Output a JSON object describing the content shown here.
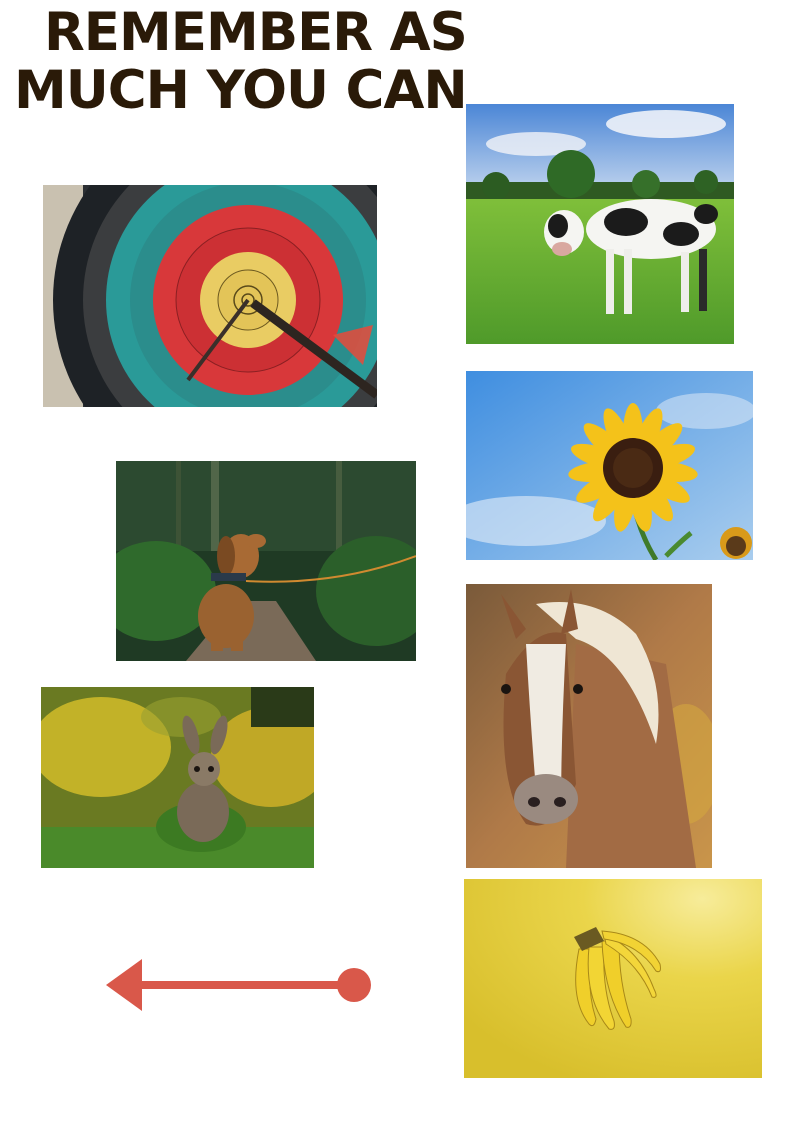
{
  "title": {
    "line1": "REMEMBER AS",
    "line2": "MUCH YOU CAN"
  },
  "photos": [
    {
      "name": "archery-target-photo"
    },
    {
      "name": "cow-photo"
    },
    {
      "name": "sunflower-photo"
    },
    {
      "name": "dog-photo"
    },
    {
      "name": "horse-photo"
    },
    {
      "name": "rabbit-photo"
    },
    {
      "name": "banana-photo"
    }
  ],
  "colors": {
    "title": "#2a1a08",
    "arrow": "#d9584a"
  },
  "icons": {
    "back": "arrow-left-icon"
  }
}
